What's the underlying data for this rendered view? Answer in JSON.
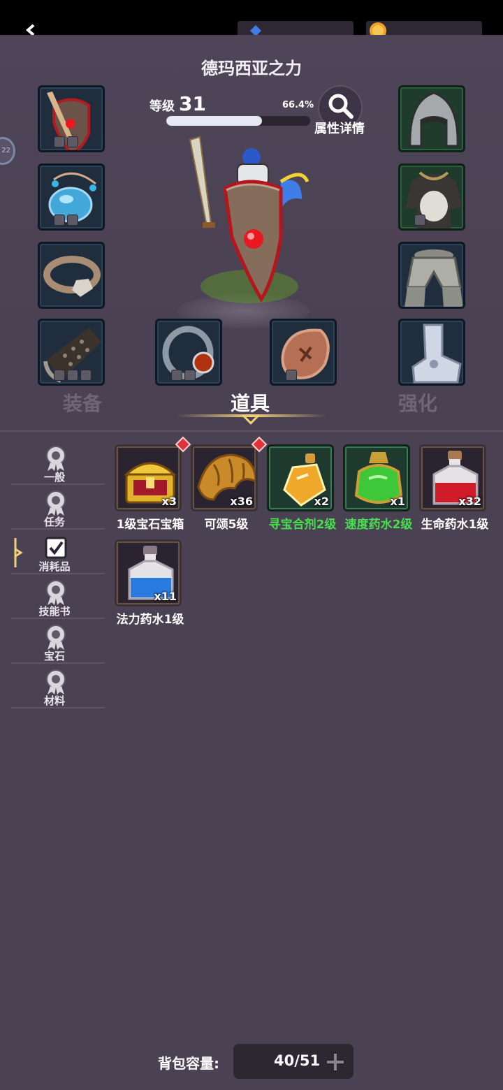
{
  "hero": {
    "name": "德玛西亚之力",
    "level_label": "等级",
    "level": "31",
    "progress_text": "66.4%",
    "progress": 0.664,
    "detail_label": "属性详情",
    "side_badge": "22"
  },
  "tabs": [
    {
      "label": "装备",
      "active": false
    },
    {
      "label": "道具",
      "active": true
    },
    {
      "label": "强化",
      "active": false
    }
  ],
  "categories": [
    {
      "label": "一般",
      "icon": "badge-icon"
    },
    {
      "label": "任务",
      "icon": "badge-icon"
    },
    {
      "label": "消耗品",
      "icon": "checkbox-icon",
      "selected": true
    },
    {
      "label": "技能书",
      "icon": "badge-icon"
    },
    {
      "label": "宝石",
      "icon": "badge-icon"
    },
    {
      "label": "材料",
      "icon": "badge-icon"
    }
  ],
  "items": [
    {
      "name": "1级宝石宝箱",
      "qty": "x3",
      "icon": "treasure-chest-icon",
      "rarity": "normal",
      "new": true
    },
    {
      "name": "可颂5级",
      "qty": "x36",
      "icon": "croissant-icon",
      "rarity": "normal",
      "new": true
    },
    {
      "name": "寻宝合剂2级",
      "qty": "x2",
      "icon": "golden-potion-icon",
      "rarity": "green",
      "new": false
    },
    {
      "name": "速度药水2级",
      "qty": "x1",
      "icon": "green-potion-icon",
      "rarity": "green",
      "new": false
    },
    {
      "name": "生命药水1级",
      "qty": "x32",
      "icon": "red-potion-icon",
      "rarity": "normal",
      "new": false
    },
    {
      "name": "法力药水1级",
      "qty": "x11",
      "icon": "blue-potion-icon",
      "rarity": "normal",
      "new": false
    }
  ],
  "bag": {
    "label": "背包容量:",
    "value": "40/51"
  },
  "colors": {
    "background": "#4a4152",
    "accent_gold": "#f4d27a",
    "green_text": "#46e04e"
  }
}
